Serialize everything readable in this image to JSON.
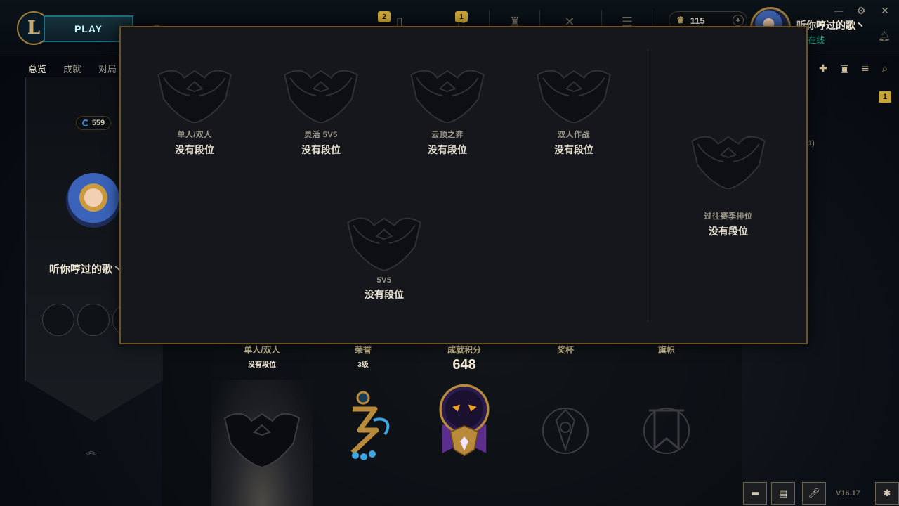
{
  "topbar": {
    "play_label": "PLAY",
    "nav_badges": [
      "2",
      "1"
    ],
    "currency_value": "115",
    "currency_add": "+",
    "summoner_name": "听你哼过的歌丶",
    "status": "在线",
    "window_controls": [
      "—",
      "⚙",
      "✕"
    ],
    "logo_letter": "L"
  },
  "tabs": [
    {
      "label": "总览",
      "active": true
    },
    {
      "label": "成就",
      "active": false
    },
    {
      "label": "对局",
      "active": false
    }
  ],
  "profile": {
    "level": "559",
    "name": "听你哼过的歌丶"
  },
  "right_panel": {
    "badge": "1",
    "fragment": "1)"
  },
  "ranked_modal": {
    "items": [
      {
        "name": "单人/双人",
        "value": "没有段位"
      },
      {
        "name": "灵活 5V5",
        "value": "没有段位"
      },
      {
        "name": "云顶之弈",
        "value": "没有段位"
      },
      {
        "name": "双人作战",
        "value": "没有段位"
      },
      {
        "name": "5V5",
        "value": "没有段位"
      }
    ],
    "past_season": {
      "name": "过往赛季排位",
      "value": "没有段位"
    }
  },
  "showcase": {
    "ranked": {
      "label": "单人/双人",
      "sub": "没有段位"
    },
    "honor": {
      "label": "荣誉",
      "sub": "3级"
    },
    "achievement": {
      "label": "成就积分",
      "score": "648"
    },
    "trophy": {
      "label": "奖杯"
    },
    "banner": {
      "label": "旗帜"
    }
  },
  "footer": {
    "version": "V16.17"
  },
  "colors": {
    "gold": "#c8aa6e",
    "modal_border": "#6a5325",
    "online": "#16b08a"
  }
}
